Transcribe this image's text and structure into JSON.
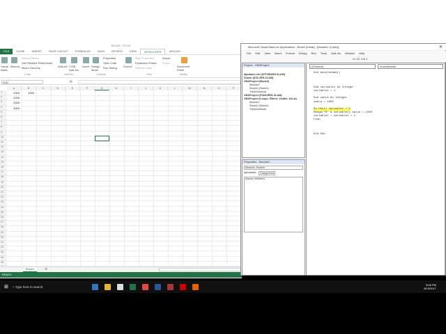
{
  "excel": {
    "title": "Book2 - Excel",
    "tabs": [
      "FILE",
      "HOME",
      "INSERT",
      "PAGE LAYOUT",
      "FORMULAS",
      "DATA",
      "REVIEW",
      "VIEW",
      "DEVELOPER",
      "ADD-INS"
    ],
    "ribbon": {
      "visual_basic": "Visual Basic",
      "macros": "Macros",
      "record_macro": "Record Macro",
      "relative_refs": "Use Relative References",
      "macro_security": "Macro Security",
      "addins": "Add-ins",
      "com_addins": "COM Add-Ins",
      "insert": "Insert",
      "design_mode": "Design Mode",
      "properties": "Properties",
      "view_code": "View Code",
      "run_dialog": "Run Dialog",
      "source": "Source",
      "map_properties": "Map Properties",
      "expansion_packs": "Expansion Packs",
      "refresh_data": "Refresh Data",
      "import": "Import",
      "export": "Export",
      "document_panel": "Document Panel",
      "groups": [
        "Code",
        "Add-Ins",
        "Controls",
        "XML",
        "Modify"
      ]
    },
    "name_box": "G10",
    "formula_symbol": "fx",
    "columns": [
      "A",
      "B",
      "C",
      "D",
      "E",
      "F",
      "G",
      "H",
      "I",
      "J",
      "K",
      "L",
      "M",
      "N",
      "O",
      "P"
    ],
    "cells": [
      {
        "ref": "A1",
        "value": "1000"
      },
      {
        "ref": "B1",
        "value": "1000"
      },
      {
        "ref": "A2",
        "value": "1000"
      },
      {
        "ref": "A3",
        "value": "1000"
      },
      {
        "ref": "A4",
        "value": "1000"
      }
    ],
    "sheet_tab": "Sheet1",
    "add_sheet": "⊕",
    "status": "READY"
  },
  "vba": {
    "title": "Microsoft Visual Basic for Applications - Book2 [break] - [Module1 (Code)]",
    "menu": [
      "File",
      "Edit",
      "View",
      "Insert",
      "Format",
      "Debug",
      "Run",
      "Tools",
      "Add-Ins",
      "Window",
      "Help"
    ],
    "position": "Ln 12, Col 1",
    "project": {
      "title": "Project - VBAProject",
      "items": [
        "atpvbaen.xls (ATPVBAEN.XLAM)",
        "Solver (SOLVER.XLAM)",
        "VBAProject (Book2)",
        "Module1",
        "Sheet1 (Sheet1)",
        "ThisWorkbook",
        "VBAProject (FUNCRES.XLAM)",
        "VBAProject (Loops, Filters, Visible, &A.xls",
        "Module1",
        "Sheet1 (Sheet1)",
        "ThisWorkbook"
      ]
    },
    "properties": {
      "title": "Properties - Module1",
      "object": "Module1 Module",
      "tabs": [
        "Alphabetic",
        "Categorized"
      ],
      "row_name": "(Name)",
      "row_value": "Module1"
    },
    "object_dropdown": "(General)",
    "proc_dropdown": "modulename",
    "code": [
      "Sub modulename()",
      "",
      "",
      "",
      "Dim variable1 As Integer",
      "variable1 = 1",
      "",
      "Dim zahra As Integer",
      "zahra = 1000",
      "",
      "Do Until variable1 > 5",
      "Range(\"B\" & variable1).Value = 1000",
      "variable1 = variable1 + 1",
      "Loop",
      "",
      "",
      "",
      "End Sub"
    ],
    "highlight_line": 10
  },
  "taskbar": {
    "search": "Type here to search",
    "time": "5:06 PM",
    "date": "8/19/2017"
  }
}
